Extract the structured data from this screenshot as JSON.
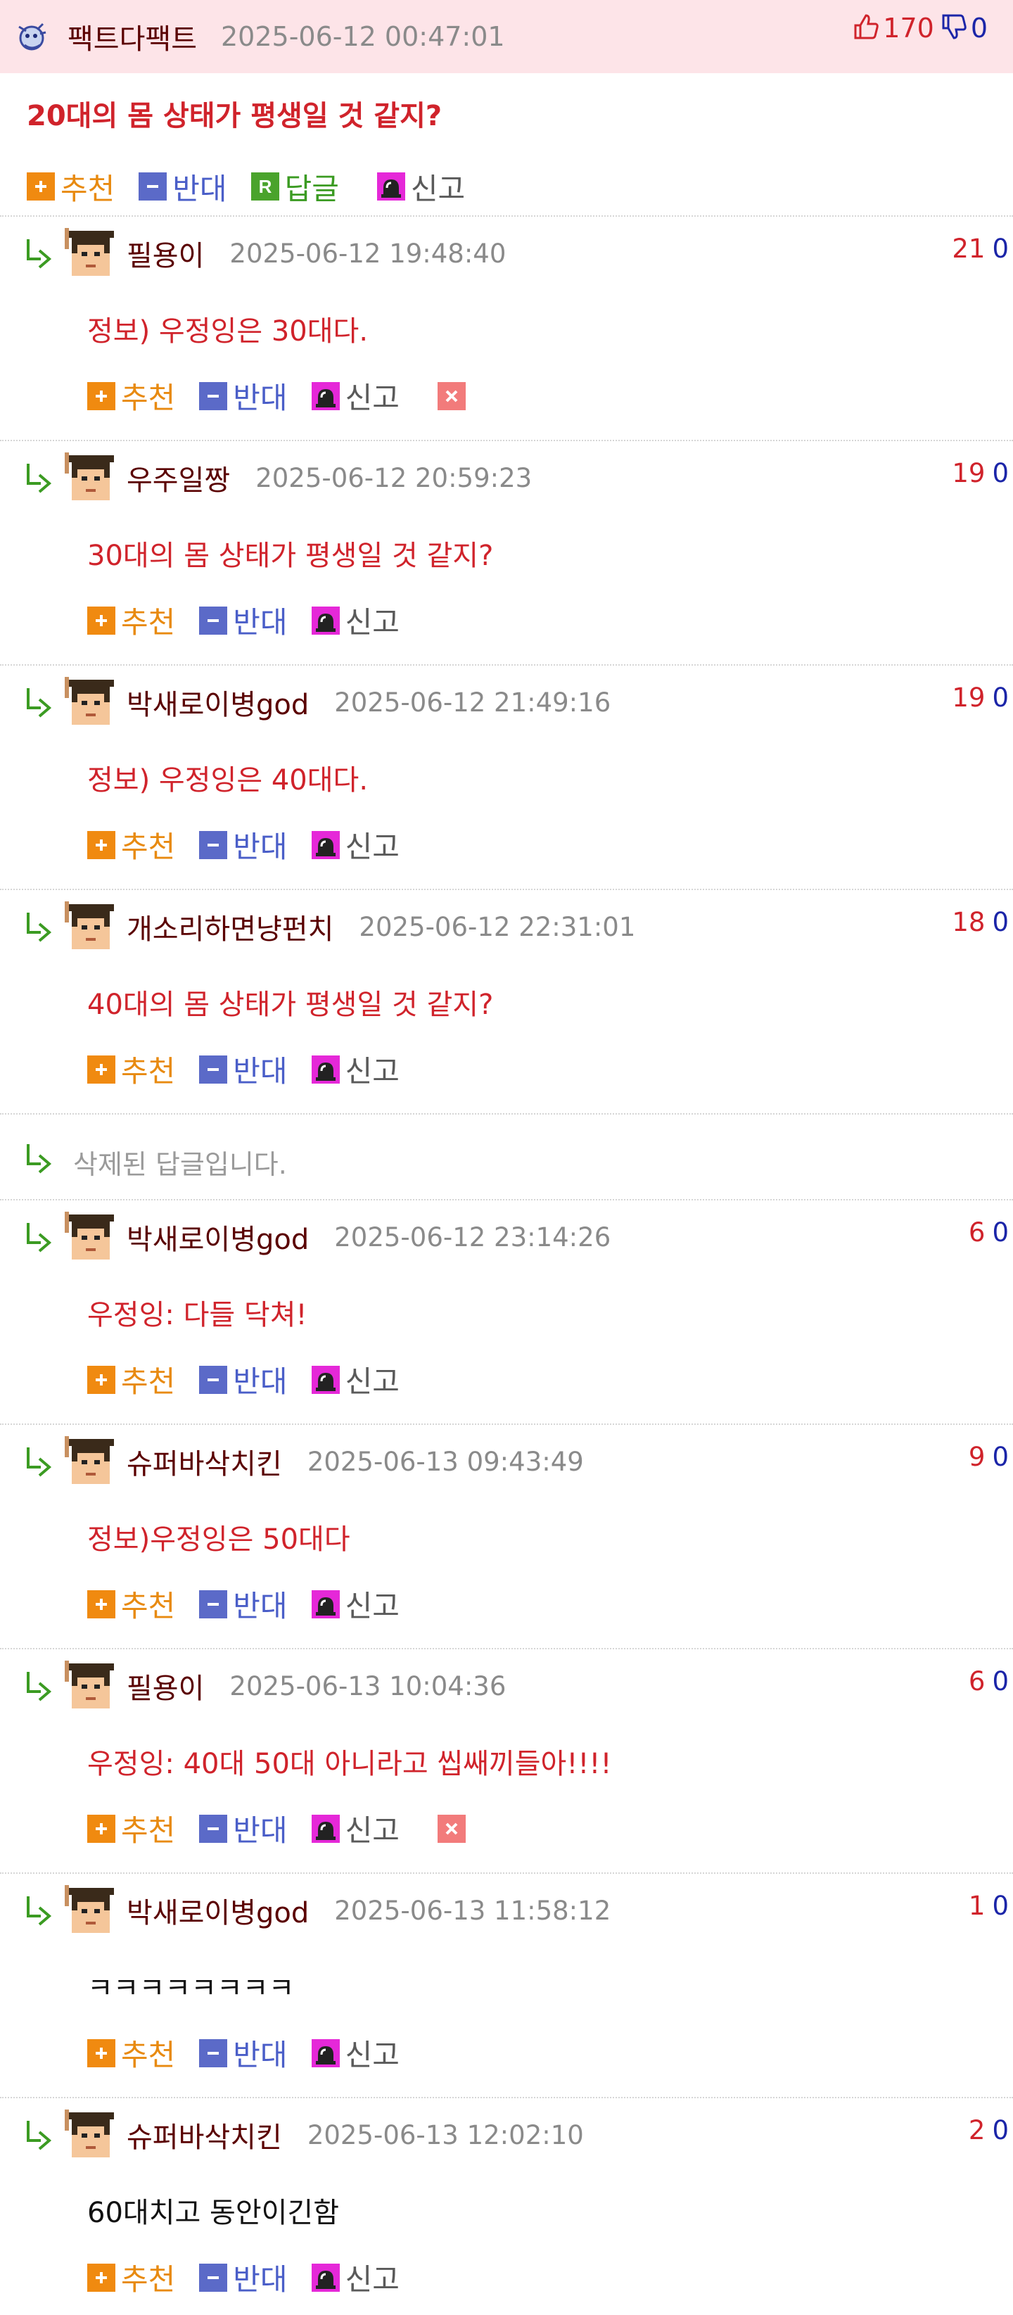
{
  "top_comment": {
    "nickname": "팩트다팩트",
    "date": "2025-06-12 00:47:01",
    "up": "170",
    "down": "0",
    "text": "20대의 몸 상태가 평생일 것 같지?",
    "actions": {
      "recommend": "추천",
      "oppose": "반대",
      "reply": "답글",
      "report": "신고"
    }
  },
  "labels": {
    "recommend": "추천",
    "oppose": "반대",
    "report": "신고"
  },
  "colors": {
    "header_bg": "#fde4e8",
    "accent_red": "#d0232b",
    "nick": "#5a0000",
    "down_blue": "#1b25a8",
    "recommend": "#e88a10",
    "oppose": "#4a5ec8",
    "reply_green": "#3b9b22"
  },
  "replies": [
    {
      "nickname": "필용이",
      "date": "2025-06-12 19:48:40",
      "up": "21",
      "down": "0",
      "text": "정보) 우정잉은 30대다.",
      "red": true,
      "deletable": true
    },
    {
      "nickname": "우주일짱",
      "date": "2025-06-12 20:59:23",
      "up": "19",
      "down": "0",
      "text": "30대의 몸 상태가 평생일 것 같지?",
      "red": true,
      "deletable": false
    },
    {
      "nickname": "박새로이병god",
      "date": "2025-06-12 21:49:16",
      "up": "19",
      "down": "0",
      "text": "정보) 우정잉은 40대다.",
      "red": true,
      "deletable": false
    },
    {
      "nickname": "개소리하면냥펀치",
      "date": "2025-06-12 22:31:01",
      "up": "18",
      "down": "0",
      "text": "40대의 몸 상태가 평생일 것 같지?",
      "red": true,
      "deletable": false
    },
    {
      "deleted": true,
      "text": "삭제된 답글입니다."
    },
    {
      "nickname": "박새로이병god",
      "date": "2025-06-12 23:14:26",
      "up": "6",
      "down": "0",
      "text": "우정잉: 다들 닥쳐!",
      "red": true,
      "deletable": false
    },
    {
      "nickname": "슈퍼바삭치킨",
      "date": "2025-06-13 09:43:49",
      "up": "9",
      "down": "0",
      "text": "정보)우정잉은 50대다",
      "red": true,
      "deletable": false
    },
    {
      "nickname": "필용이",
      "date": "2025-06-13 10:04:36",
      "up": "6",
      "down": "0",
      "text": "우정잉: 40대 50대 아니라고 씹쌔끼들아!!!!",
      "red": true,
      "deletable": true
    },
    {
      "nickname": "박새로이병god",
      "date": "2025-06-13 11:58:12",
      "up": "1",
      "down": "0",
      "text": "ㅋㅋㅋㅋㅋㅋㅋㅋ",
      "red": false,
      "deletable": false
    },
    {
      "nickname": "슈퍼바삭치킨",
      "date": "2025-06-13 12:02:10",
      "up": "2",
      "down": "0",
      "text": "60대치고 동안이긴함",
      "red": false,
      "deletable": false
    }
  ]
}
